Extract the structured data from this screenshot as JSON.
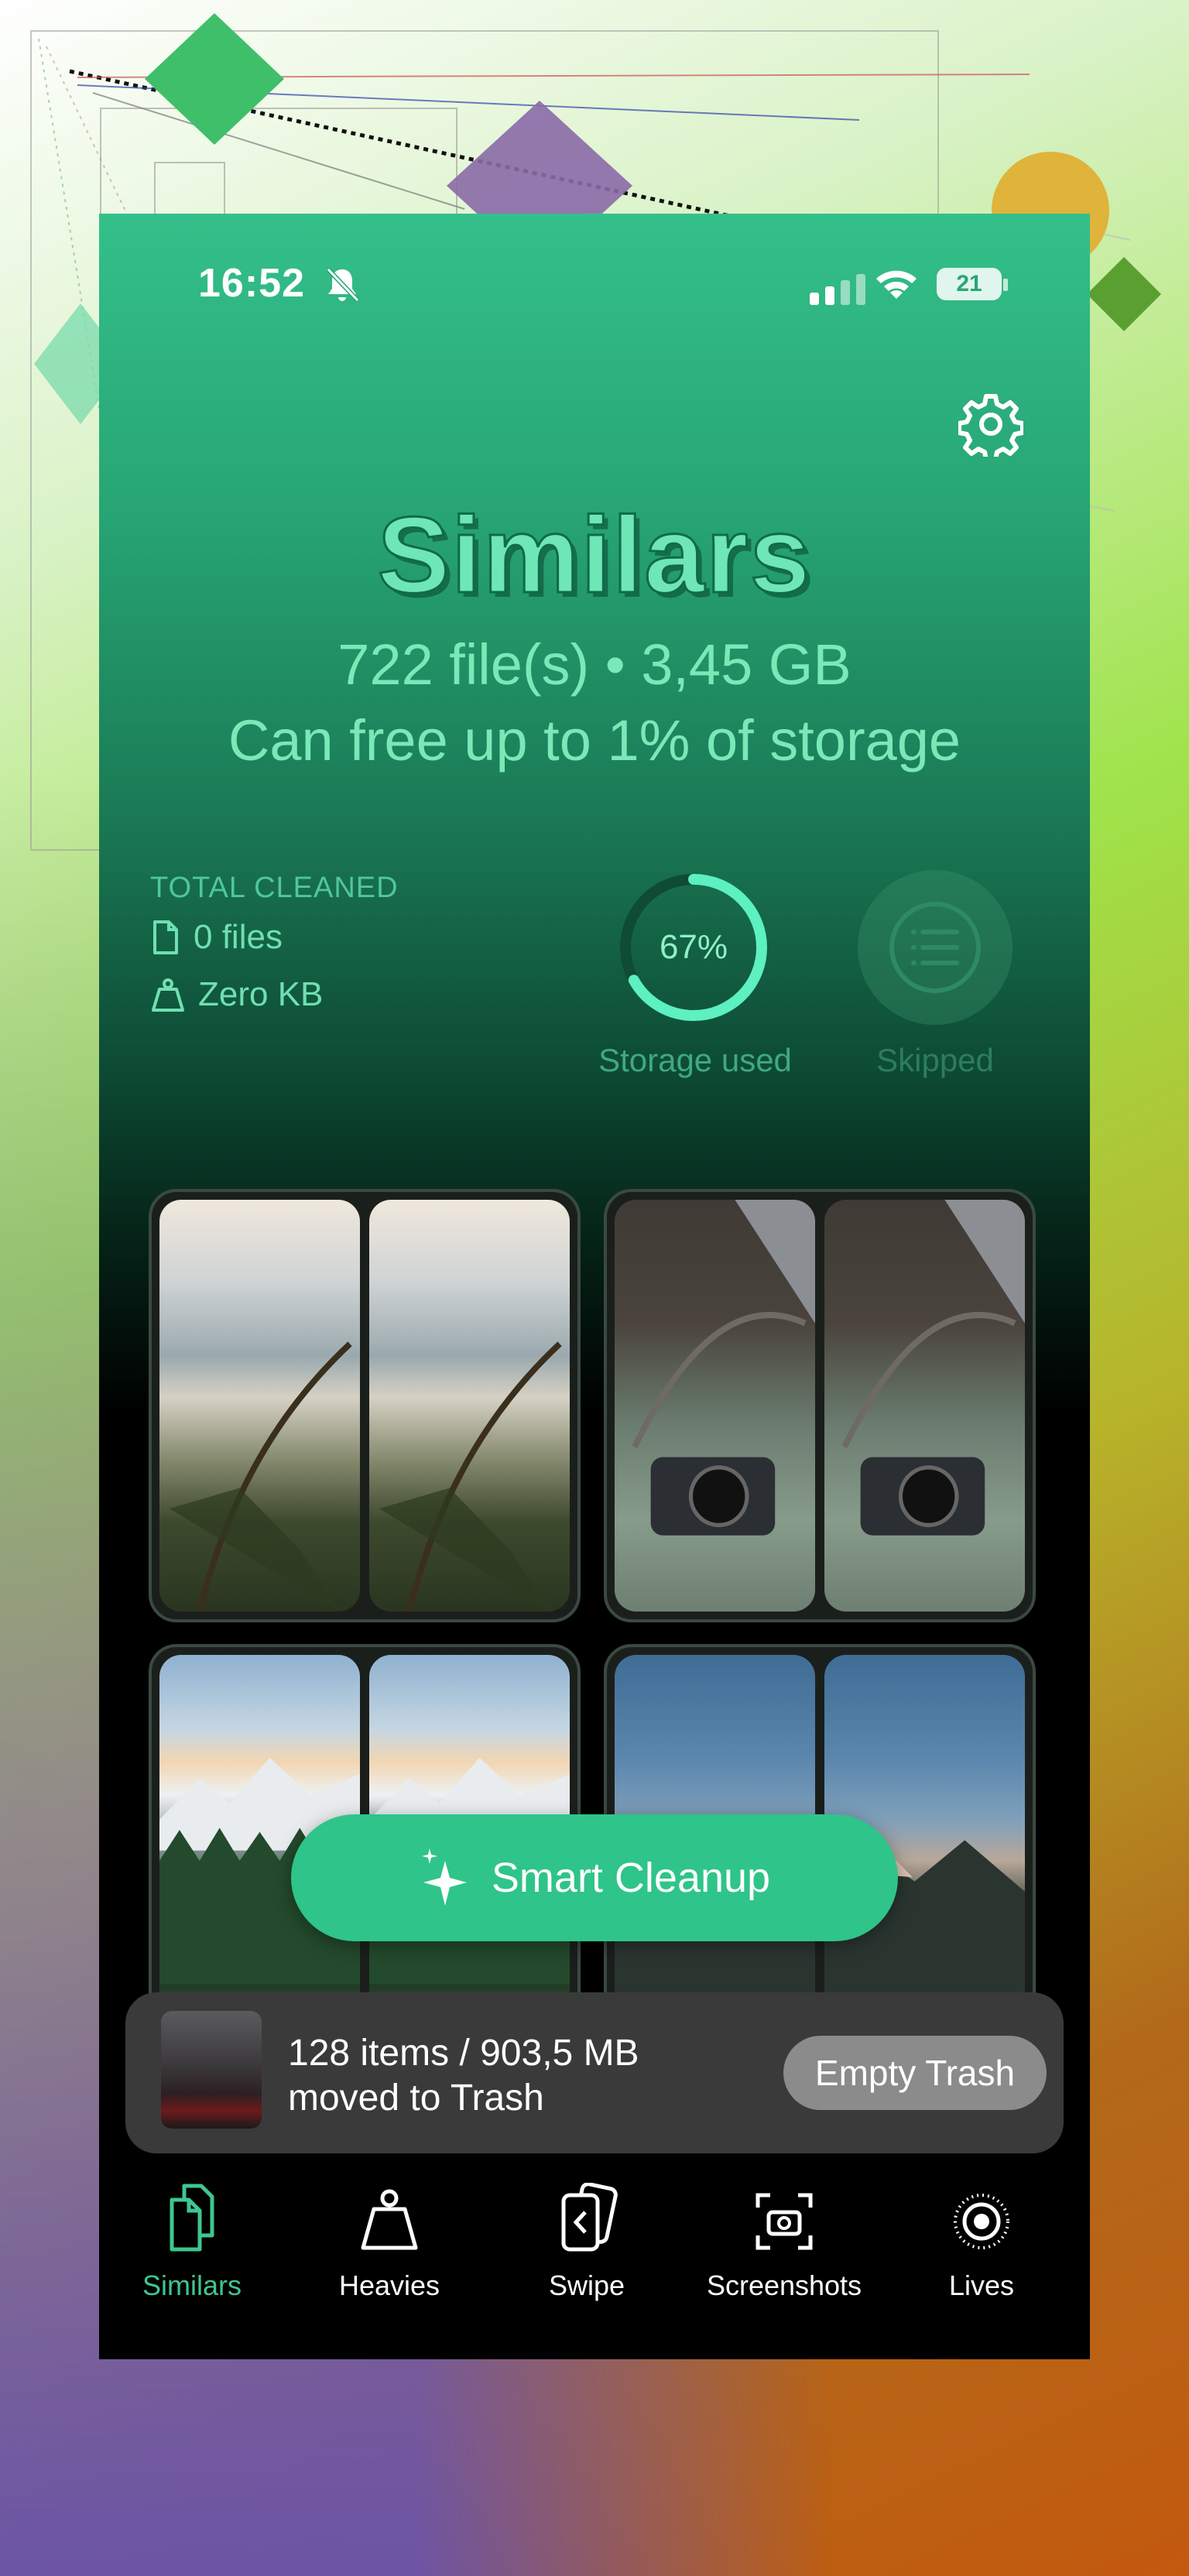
{
  "status_bar": {
    "time": "16:52",
    "battery": "21"
  },
  "header": {
    "title": "Similars",
    "summary": "722 file(s) • 3,45 GB",
    "free_up": "Can free up to 1% of storage"
  },
  "stats": {
    "total_cleaned_label": "TOTAL CLEANED",
    "files": "0 files",
    "size": "Zero KB",
    "storage_percent_text": "67%",
    "storage_fraction": 0.67,
    "storage_label": "Storage used",
    "skipped_label": "Skipped"
  },
  "smart_cleanup": {
    "label": "Smart Cleanup"
  },
  "trash_toast": {
    "line1": "128 items / 903,5 MB",
    "line2": "moved to Trash",
    "button": "Empty Trash"
  },
  "tabs": [
    {
      "label": "Similars",
      "icon": "similars-icon",
      "active": true
    },
    {
      "label": "Heavies",
      "icon": "weight-icon",
      "active": false
    },
    {
      "label": "Swipe",
      "icon": "swipe-icon",
      "active": false
    },
    {
      "label": "Screenshots",
      "icon": "screenshot-icon",
      "active": false
    },
    {
      "label": "Lives",
      "icon": "live-photo-icon",
      "active": false
    }
  ],
  "colors": {
    "accent": "#2fc489",
    "accent_text": "#7be8b7",
    "tab_active": "#3ec690"
  }
}
